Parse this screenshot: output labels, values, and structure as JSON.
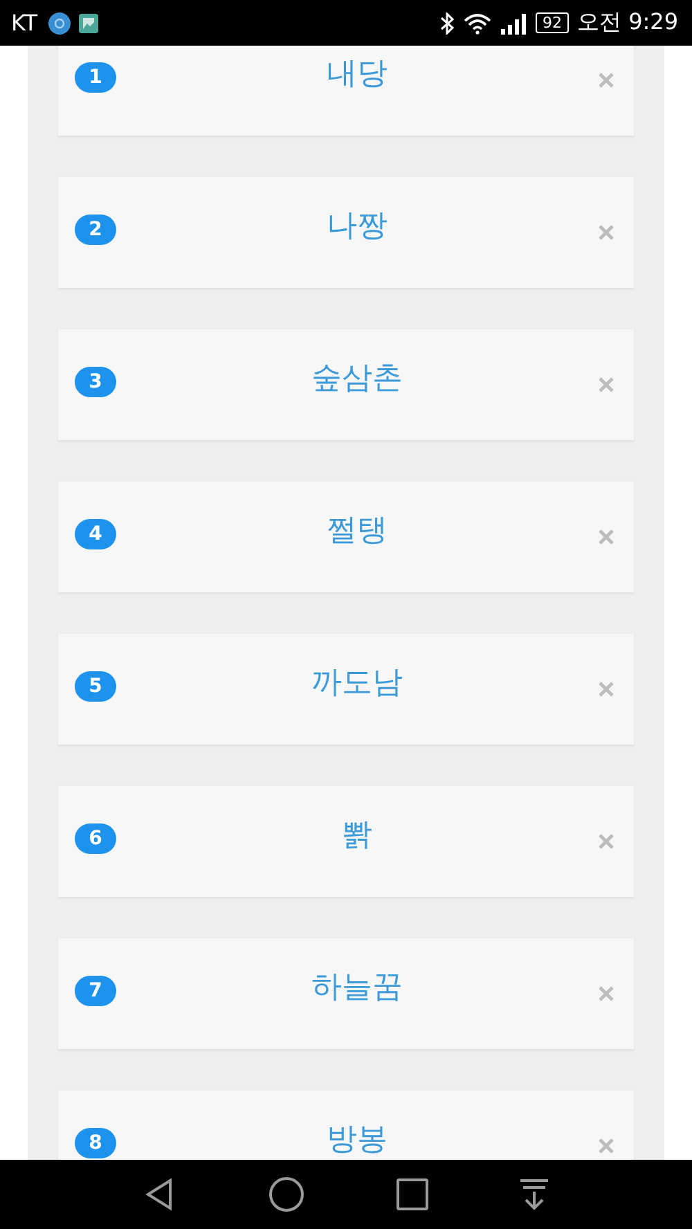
{
  "status_bar": {
    "carrier": "KT",
    "battery": "92",
    "time": "오전 9:29"
  },
  "items": [
    {
      "number": "1",
      "name": "내당"
    },
    {
      "number": "2",
      "name": "나짱"
    },
    {
      "number": "3",
      "name": "숲삼촌"
    },
    {
      "number": "4",
      "name": "쩔탱"
    },
    {
      "number": "5",
      "name": "까도남"
    },
    {
      "number": "6",
      "name": "뽥"
    },
    {
      "number": "7",
      "name": "하늘꿈"
    },
    {
      "number": "8",
      "name": "방봉"
    }
  ]
}
